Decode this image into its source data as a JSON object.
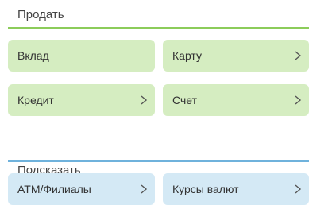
{
  "colors": {
    "sell_divider": "#8ccc5a",
    "suggest_divider": "#6fb2dc",
    "sell_tile": "#d5edc1",
    "suggest_tile": "#d4e9f5"
  },
  "sell": {
    "title": "Продать",
    "items": [
      {
        "label": "Вклад",
        "icon": "chevron-right-icon"
      },
      {
        "label": "Карту",
        "icon": "chevron-right-icon"
      },
      {
        "label": "Кредит",
        "icon": "chevron-right-icon"
      },
      {
        "label": "Счет",
        "icon": "chevron-right-icon"
      }
    ]
  },
  "suggest": {
    "title": "Подсказать",
    "items": [
      {
        "label": "ATM/Филиалы",
        "icon": "chevron-right-icon"
      },
      {
        "label": "Курсы валют",
        "icon": "chevron-right-icon"
      }
    ]
  }
}
